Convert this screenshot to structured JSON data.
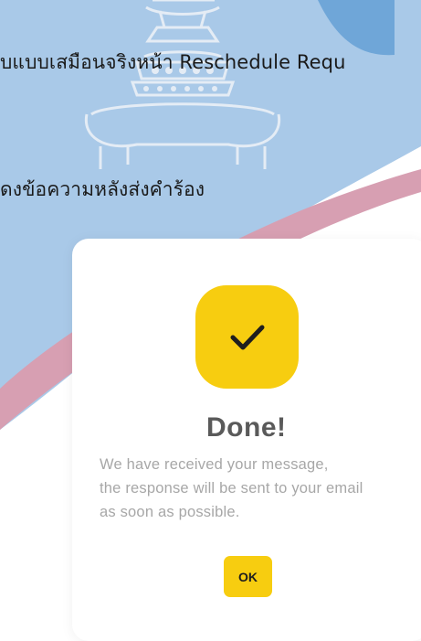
{
  "document": {
    "line1": "บแบบเสมือนจริงหน้า Reschedule Requ",
    "line2": "ดงข้อความหลังส่งคำร้อง"
  },
  "dialog": {
    "icon": "checkmark-icon",
    "title": "Done!",
    "message_lines": [
      "We have received your message,",
      "the response will be sent to your email",
      "as soon as possible."
    ],
    "ok_label": "OK"
  },
  "colors": {
    "accent": "#f7cd10",
    "background_blue": "#a9c9e8",
    "background_pink": "#d79fb2",
    "title_gray": "#5a5a5a",
    "message_gray": "#a7a7a7"
  }
}
